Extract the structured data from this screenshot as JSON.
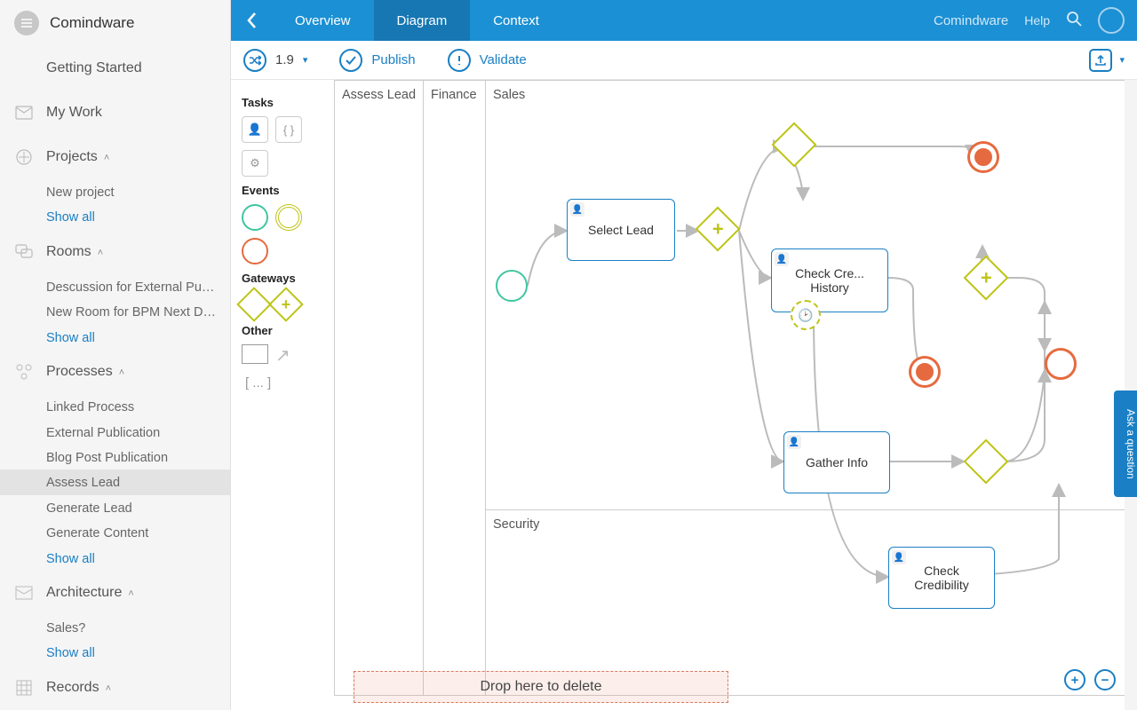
{
  "brand": "Comindware",
  "sidebar": {
    "getting_started": "Getting Started",
    "my_work": "My Work",
    "projects": {
      "label": "Projects",
      "items": [
        "New project"
      ],
      "show_all": "Show all"
    },
    "rooms": {
      "label": "Rooms",
      "items": [
        "Descussion for External Publ...",
        "New Room for BPM Next De..."
      ],
      "show_all": "Show all"
    },
    "processes": {
      "label": "Processes",
      "items": [
        "Linked Process",
        "External Publication",
        "Blog Post Publication",
        "Assess Lead",
        "Generate Lead",
        "Generate Content"
      ],
      "selected_index": 3,
      "show_all": "Show all"
    },
    "architecture": {
      "label": "Architecture",
      "items": [
        "Sales?"
      ],
      "show_all": "Show all"
    },
    "records": {
      "label": "Records"
    }
  },
  "topbar": {
    "tabs": [
      "Overview",
      "Diagram",
      "Context"
    ],
    "active": 1,
    "logo": "Comindware",
    "help": "Help"
  },
  "toolbar": {
    "version": "1.9",
    "publish": "Publish",
    "validate": "Validate"
  },
  "palette": {
    "tasks": "Tasks",
    "events": "Events",
    "gateways": "Gateways",
    "other": "Other"
  },
  "pool": {
    "title": "Assess Lead",
    "lanes": [
      "Finance",
      "Sales",
      "Security"
    ],
    "tasks": {
      "select_lead": "Select Lead",
      "check_credit": "Check Cre... History",
      "gather_info": "Gather Info",
      "check_credibility": "Check Credibility"
    }
  },
  "dropzone": "Drop here to delete",
  "ask": "Ask a question"
}
